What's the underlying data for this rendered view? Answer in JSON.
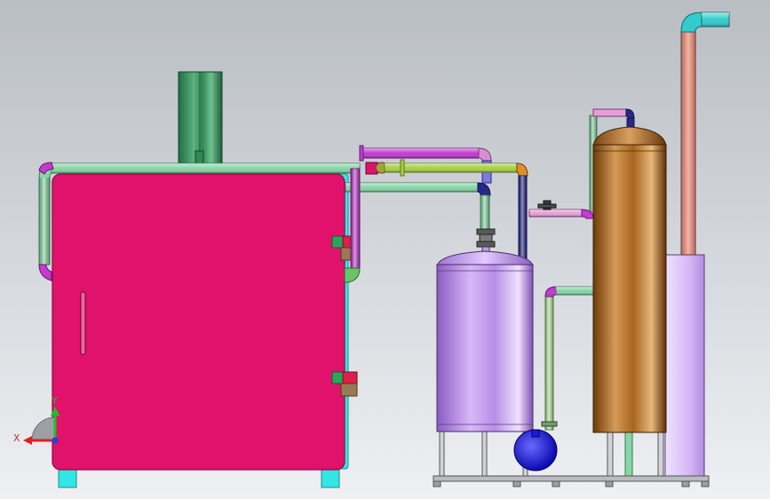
{
  "viewport": {
    "background_top": "#b9bec4",
    "background_bottom": "#eef0f3"
  },
  "triad": {
    "x_label": "X",
    "y_label": "Y",
    "x_color": "#e02020",
    "y_color": "#20c020",
    "z_color": "#2040e0"
  },
  "colors": {
    "oven_body": "#e0126c",
    "oven_frame": "#33e6e6",
    "chimney": "#2f8a55",
    "pipe_green": "#86d6a6",
    "pipe_magenta": "#c23cd0",
    "pipe_yellowgreen": "#a8cf45",
    "pipe_navy": "#28288a",
    "pipe_pink": "#d98fcf",
    "pipe_lightgreen": "#b8e6a4",
    "tank_purple": "#b98ee6",
    "tower_brown": "#a8641e",
    "tower_lavender": "#d7b8f6",
    "pipe_salmon": "#e2988a",
    "elbow_cyan": "#33cccc",
    "pump_blue": "#1a1ae0",
    "base_frame": "#b8bcc2"
  }
}
